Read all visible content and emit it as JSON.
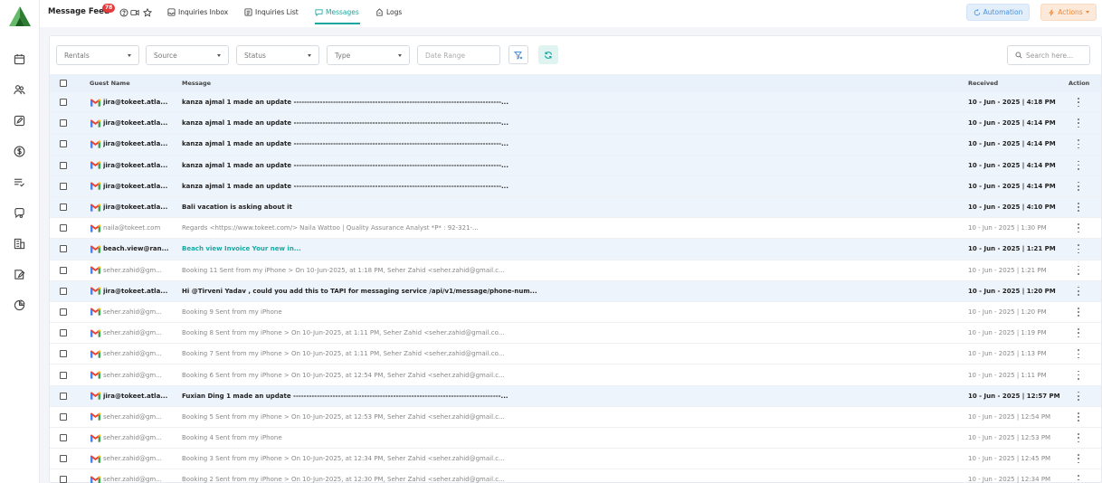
{
  "topbar": {
    "title": "Message Feed",
    "badge": "78",
    "links": [
      "Inquiries Inbox",
      "Inquiries List",
      "Messages",
      "Logs"
    ],
    "automation_label": "Automation",
    "actions_label": "Actions"
  },
  "filters": {
    "rentals": "Rentals",
    "source": "Source",
    "status": "Status",
    "type": "Type",
    "date_range": "Date Range",
    "search_placeholder": "Search here..."
  },
  "table": {
    "headers": [
      "Guest Name",
      "Message",
      "Received",
      "Action"
    ],
    "rows": [
      {
        "guest": "jira@tokeet.atla...",
        "message": "kanza ajmal 1 made an update -------------------------------------------------------------------------------...",
        "received": "10 - Jun - 2025 | 4:18 PM",
        "unread": true
      },
      {
        "guest": "jira@tokeet.atla...",
        "message": "kanza ajmal 1 made an update -------------------------------------------------------------------------------...",
        "received": "10 - Jun - 2025 | 4:14 PM",
        "unread": true
      },
      {
        "guest": "jira@tokeet.atla...",
        "message": "kanza ajmal 1 made an update -------------------------------------------------------------------------------...",
        "received": "10 - Jun - 2025 | 4:14 PM",
        "unread": true
      },
      {
        "guest": "jira@tokeet.atla...",
        "message": "kanza ajmal 1 made an update -------------------------------------------------------------------------------...",
        "received": "10 - Jun - 2025 | 4:14 PM",
        "unread": true
      },
      {
        "guest": "jira@tokeet.atla...",
        "message": "kanza ajmal 1 made an update -------------------------------------------------------------------------------...",
        "received": "10 - Jun - 2025 | 4:14 PM",
        "unread": true
      },
      {
        "guest": "jira@tokeet.atla...",
        "message": "Bali vacation is asking about it",
        "received": "10 - Jun - 2025 | 4:10 PM",
        "unread": true
      },
      {
        "guest": "naila@tokeet.com",
        "message": "Regards <https://www.tokeet.com/> Naila Wattoo | Quality Assurance Analyst *P* : 92-321-...",
        "received": "10 - Jun - 2025 | 1:30 PM",
        "unread": false
      },
      {
        "guest": "beach.view@ran...",
        "message": "Beach view Invoice Your new in...",
        "received": "10 - Jun - 2025 | 1:21 PM",
        "unread": true,
        "link": true
      },
      {
        "guest": "seher.zahid@gm...",
        "message": "Booking 11 Sent from my iPhone > On 10-Jun-2025, at 1:18 PM, Seher Zahid <seher.zahid@gmail.c...",
        "received": "10 - Jun - 2025 | 1:21 PM",
        "unread": false
      },
      {
        "guest": "jira@tokeet.atla...",
        "message": "Hi @Tirveni Yadav , could you add this to TAPI for messaging service /api/v1/message/phone-num...",
        "received": "10 - Jun - 2025 | 1:20 PM",
        "unread": true
      },
      {
        "guest": "seher.zahid@gm...",
        "message": "Booking 9 Sent from my iPhone",
        "received": "10 - Jun - 2025 | 1:20 PM",
        "unread": false
      },
      {
        "guest": "seher.zahid@gm...",
        "message": "Booking 8 Sent from my iPhone > On 10-Jun-2025, at 1:11 PM, Seher Zahid <seher.zahid@gmail.co...",
        "received": "10 - Jun - 2025 | 1:19 PM",
        "unread": false
      },
      {
        "guest": "seher.zahid@gm...",
        "message": "Booking 7 Sent from my iPhone > On 10-Jun-2025, at 1:11 PM, Seher Zahid <seher.zahid@gmail.co...",
        "received": "10 - Jun - 2025 | 1:13 PM",
        "unread": false
      },
      {
        "guest": "seher.zahid@gm...",
        "message": "Booking 6 Sent from my iPhone > On 10-Jun-2025, at 12:54 PM, Seher Zahid <seher.zahid@gmail.c...",
        "received": "10 - Jun - 2025 | 1:11 PM",
        "unread": false
      },
      {
        "guest": "jira@tokeet.atla...",
        "message": "Fuxian Ding 1 made an update -------------------------------------------------------------------------------...",
        "received": "10 - Jun - 2025 | 12:57 PM",
        "unread": true
      },
      {
        "guest": "seher.zahid@gm...",
        "message": "Booking 5 Sent from my iPhone > On 10-Jun-2025, at 12:53 PM, Seher Zahid <seher.zahid@gmail.c...",
        "received": "10 - Jun - 2025 | 12:54 PM",
        "unread": false
      },
      {
        "guest": "seher.zahid@gm...",
        "message": "Booking 4 Sent from my iPhone",
        "received": "10 - Jun - 2025 | 12:53 PM",
        "unread": false
      },
      {
        "guest": "seher.zahid@gm...",
        "message": "Booking 3 Sent from my iPhone > On 10-Jun-2025, at 12:34 PM, Seher Zahid <seher.zahid@gmail.c...",
        "received": "10 - Jun - 2025 | 12:45 PM",
        "unread": false
      },
      {
        "guest": "seher.zahid@gm...",
        "message": "Booking 2 Sent from my iPhone > On 10-Jun-2025, at 12:30 PM, Seher Zahid <seher.zahid@gmail.c...",
        "received": "10 - Jun - 2025 | 12:34 PM",
        "unread": false
      }
    ]
  },
  "colors": {
    "accent": "#1aa7a0",
    "badge": "#e23b3b",
    "automation": "#4a90d9",
    "actions": "#f08a3c"
  },
  "icons": {
    "sidebar": [
      "calendar-icon",
      "guests-icon",
      "edit-icon",
      "dollar-icon",
      "checklist-icon",
      "chat-icon",
      "building-icon",
      "contract-icon",
      "pie-chart-icon"
    ]
  }
}
